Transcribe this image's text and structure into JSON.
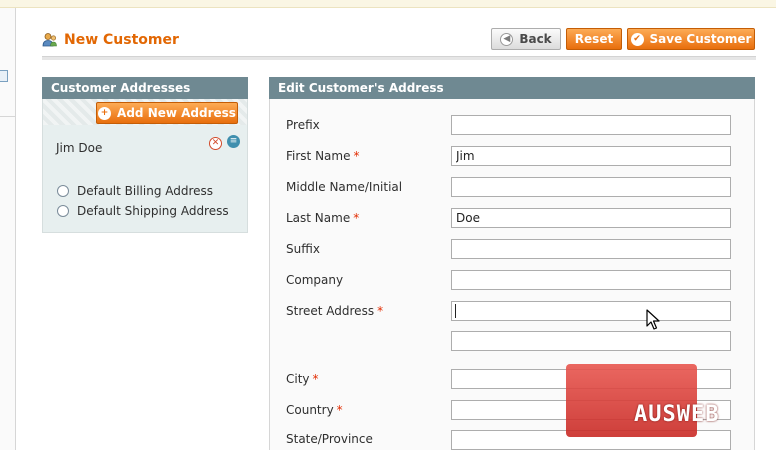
{
  "page": {
    "title": "New Customer"
  },
  "toolbar": {
    "back_label": "Back",
    "reset_label": "Reset",
    "save_label": "Save Customer"
  },
  "addresses": {
    "heading": "Customer Addresses",
    "add_label": "Add New Address",
    "items": [
      {
        "name": "Jim Doe"
      }
    ],
    "default_billing_label": "Default Billing Address",
    "default_shipping_label": "Default Shipping Address"
  },
  "form": {
    "heading": "Edit Customer's Address",
    "required_mark": "*",
    "fields": {
      "prefix": {
        "label": "Prefix",
        "value": ""
      },
      "first_name": {
        "label": "First Name",
        "value": "Jim"
      },
      "middle_name": {
        "label": "Middle Name/Initial",
        "value": ""
      },
      "last_name": {
        "label": "Last Name",
        "value": "Doe"
      },
      "suffix": {
        "label": "Suffix",
        "value": ""
      },
      "company": {
        "label": "Company",
        "value": ""
      },
      "street_address": {
        "label": "Street Address",
        "value": "",
        "value2": ""
      },
      "city": {
        "label": "City",
        "value": ""
      },
      "country": {
        "label": "Country",
        "value": ""
      },
      "state_province": {
        "label": "State/Province",
        "value": ""
      }
    }
  },
  "watermark": {
    "text": "AUSWEB"
  },
  "colors": {
    "accent_orange": "#e26703",
    "panel_header": "#6f8992",
    "required": "#e22b00"
  }
}
